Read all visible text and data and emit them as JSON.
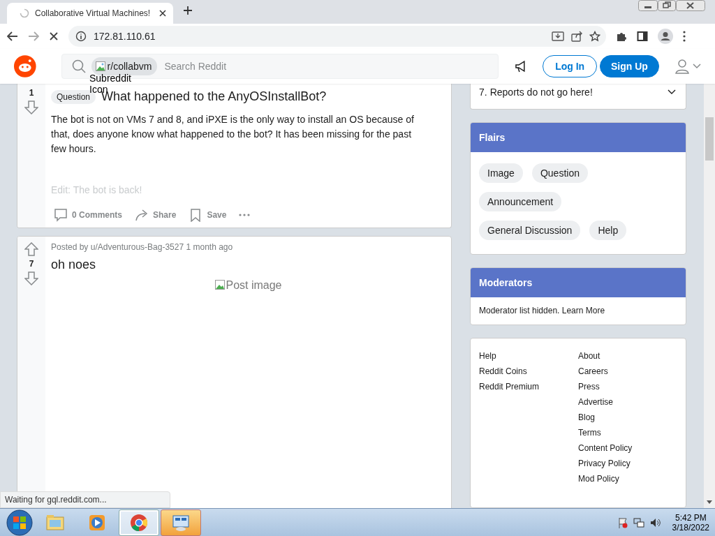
{
  "browser": {
    "tab_title": "Collaborative Virtual Machines!",
    "loading": true,
    "address": "172.81.110.61",
    "status_text": "Waiting for gql.reddit.com..."
  },
  "header": {
    "subreddit": "r/collabvm",
    "subreddit_icon_alt": "Subreddit Icon",
    "search_placeholder": "Search Reddit",
    "login": "Log In",
    "signup": "Sign Up"
  },
  "posts": [
    {
      "votes": "1",
      "flair": "Question",
      "title": "What happened to the AnyOSInstallBot?",
      "body": "The bot is not on VMs 7 and 8, and iPXE is the only way to install an OS because of that, does anyone know what happened to the bot? It has been missing for the past few hours.",
      "faded_text": "Edit: The bot is back!",
      "actions": [
        {
          "kind": "comment",
          "label": "0 Comments"
        },
        {
          "kind": "share",
          "label": "Share"
        },
        {
          "kind": "save",
          "label": "Save"
        }
      ]
    },
    {
      "votes": "7",
      "meta": "Posted by u/Adventurous-Bag-3527 1 month ago",
      "title": "oh noes",
      "image_alt": "Post image"
    }
  ],
  "sidebar": {
    "rule": {
      "number": "7.",
      "text": "Reports do not go here!"
    },
    "flairs": {
      "title": "Flairs",
      "items": [
        "Image",
        "Question",
        "Announcement",
        "General Discussion",
        "Help"
      ]
    },
    "moderators": {
      "title": "Moderators",
      "text": "Moderator list hidden.",
      "link": "Learn More"
    },
    "footer": {
      "column_1": [
        "Help",
        "Reddit Coins",
        "Reddit Premium"
      ],
      "column_2": [
        "About",
        "Careers",
        "Press",
        "Advertise",
        "Blog",
        "Terms",
        "Content Policy",
        "Privacy Policy",
        "Mod Policy"
      ]
    }
  },
  "taskbar": {
    "apps": [
      {
        "kind": "explorer",
        "selected": false
      },
      {
        "kind": "media",
        "selected": false
      },
      {
        "kind": "chrome",
        "selected": true
      },
      {
        "kind": "vm",
        "selected": false,
        "flashing": true
      }
    ],
    "time": "5:42 PM",
    "date": "3/18/2022"
  }
}
